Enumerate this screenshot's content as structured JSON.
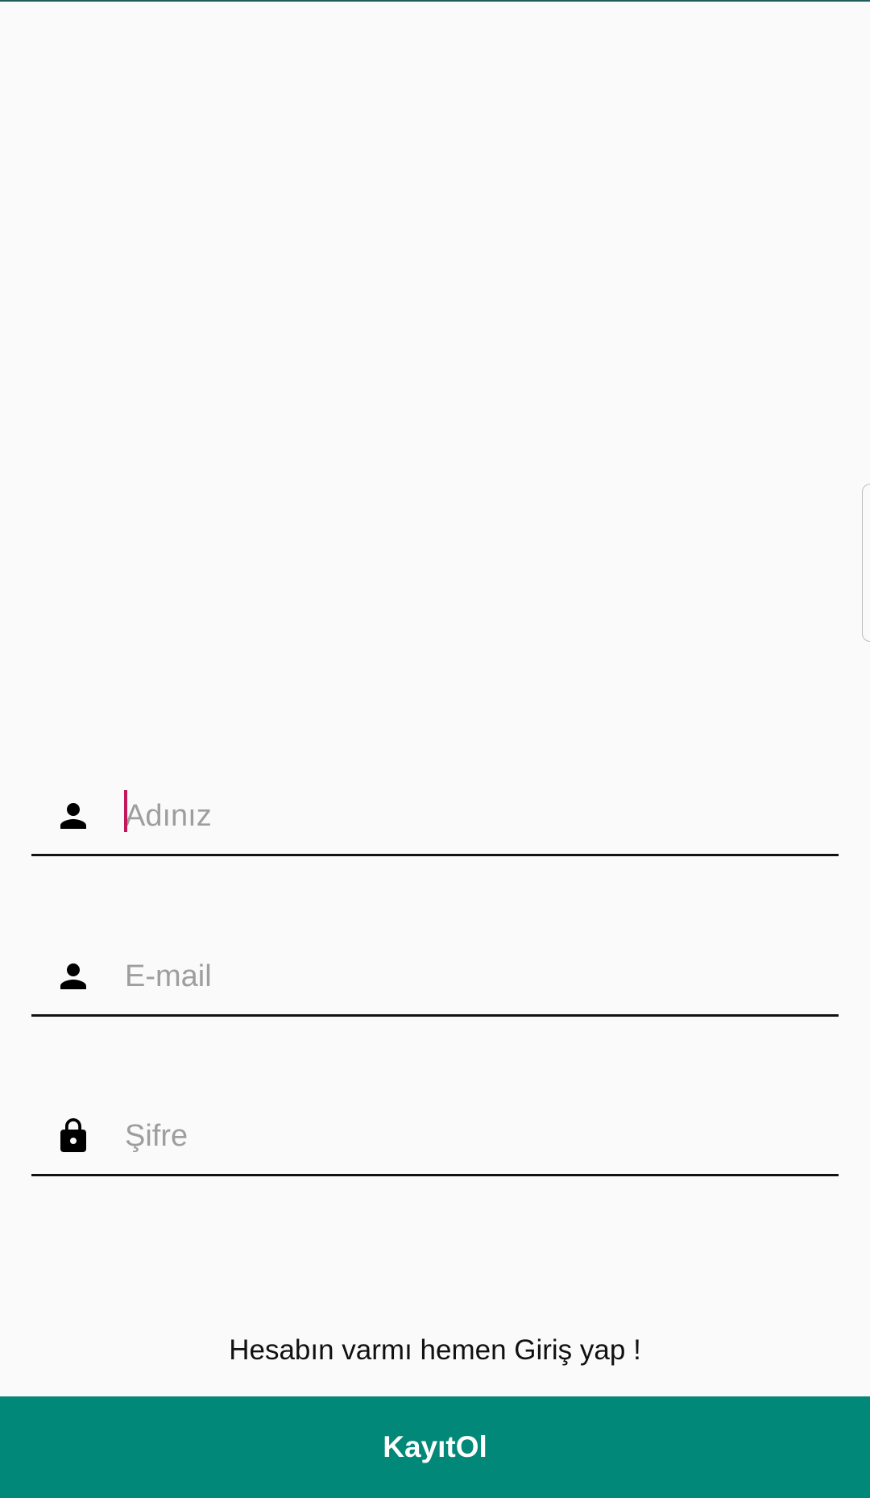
{
  "form": {
    "name_field": {
      "placeholder": "Adınız",
      "value": "",
      "icon": "person-icon"
    },
    "email_field": {
      "placeholder": "E-mail",
      "value": "",
      "icon": "person-icon"
    },
    "password_field": {
      "placeholder": "Şifre",
      "value": "",
      "icon": "lock-icon"
    }
  },
  "login_link": "Hesabın varmı hemen Giriş yap !",
  "register_button": {
    "label": "KayıtOl"
  },
  "colors": {
    "accent": "#028878",
    "caret": "#c2185b",
    "background": "#fafafa"
  }
}
